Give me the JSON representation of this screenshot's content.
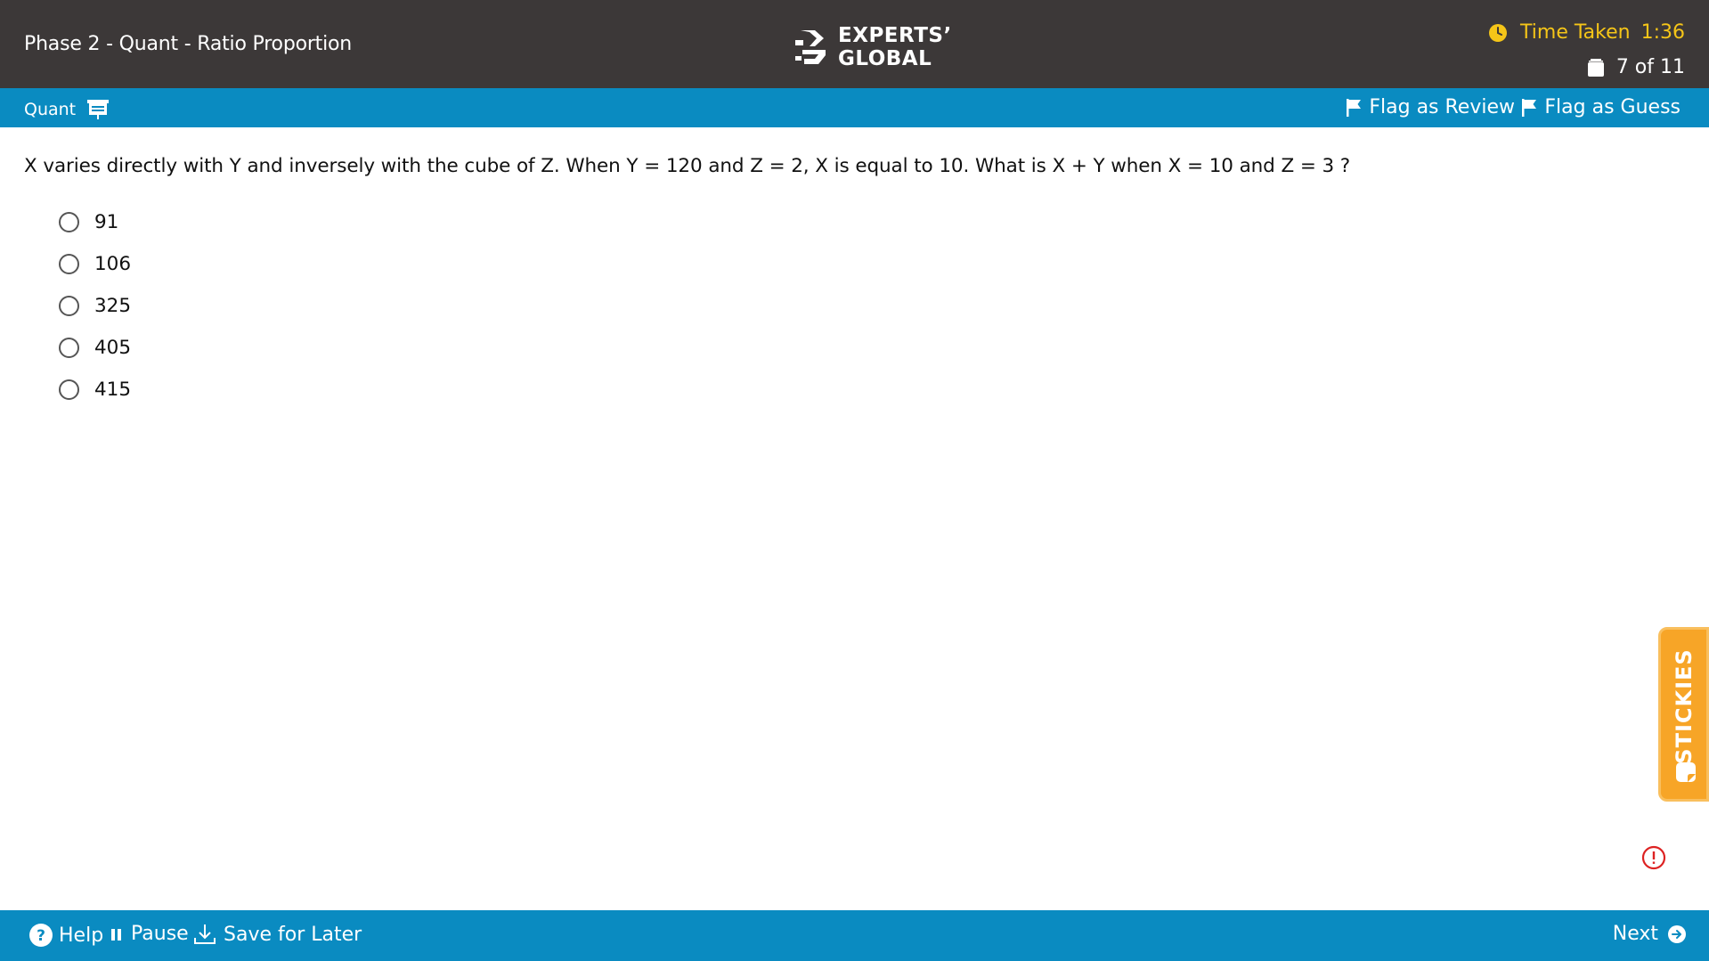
{
  "header": {
    "exam_title": "Phase 2 - Quant - Ratio Proportion",
    "logo_line1": "EXPERTS’",
    "logo_line2": "GLOBAL",
    "timer_label": "Time Taken",
    "timer_value": "1:36",
    "progress": "7 of 11",
    "timer_color": "#f5c518",
    "bg_color": "#3c3838"
  },
  "section_bar": {
    "section_name": "Quant",
    "flag_review_label": "Flag as Review",
    "flag_guess_label": "Flag as Guess",
    "bg_color": "#0a8bc1"
  },
  "question": {
    "text": "X varies directly with Y and inversely with the cube of Z. When Y = 120 and Z = 2, X is equal to 10. What is X + Y when X = 10 and Z = 3 ?",
    "options": [
      {
        "label": "91",
        "selected": false
      },
      {
        "label": "106",
        "selected": false
      },
      {
        "label": "325",
        "selected": false
      },
      {
        "label": "405",
        "selected": false
      },
      {
        "label": "415",
        "selected": false
      }
    ]
  },
  "stickies": {
    "label": "STICKIES",
    "color": "#f7a527"
  },
  "footer": {
    "help_label": "Help",
    "pause_label": "Pause",
    "save_label": "Save for Later",
    "next_label": "Next"
  },
  "icons": [
    "clock-icon",
    "clipboard-icon",
    "calculator-icon",
    "flag-icon",
    "sticky-note-icon",
    "report-icon",
    "help-icon",
    "pause-icon",
    "download-icon",
    "arrow-right-circle-icon"
  ]
}
